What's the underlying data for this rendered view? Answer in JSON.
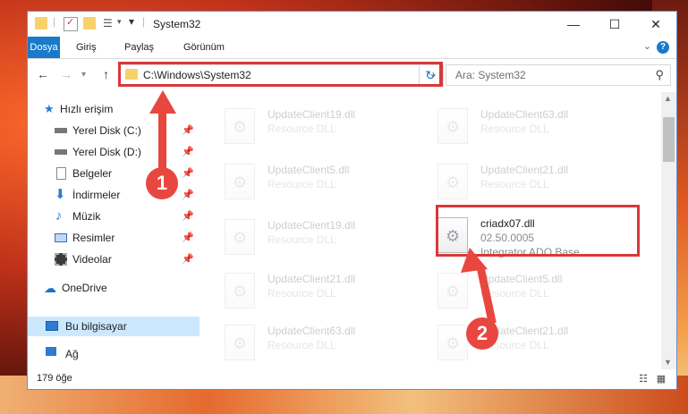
{
  "titlebar": {
    "title": "System32"
  },
  "ribbon": {
    "tabs": [
      "Dosya",
      "Giriş",
      "Paylaş",
      "Görünüm"
    ],
    "help_symbol": "?",
    "expand_symbol": "⌄"
  },
  "nav": {
    "address": "C:\\Windows\\System32",
    "search_placeholder": "Ara: System32"
  },
  "sidebar": {
    "items": [
      {
        "label": "Hızlı erişim",
        "icon": "star-icon"
      },
      {
        "label": "Yerel Disk (C:)",
        "icon": "drive-icon",
        "pinned": true
      },
      {
        "label": "Yerel Disk (D:)",
        "icon": "drive-icon",
        "pinned": true
      },
      {
        "label": "Belgeler",
        "icon": "documents-icon",
        "pinned": true
      },
      {
        "label": "İndirmeler",
        "icon": "download-icon",
        "pinned": true
      },
      {
        "label": "Müzik",
        "icon": "music-icon",
        "pinned": true
      },
      {
        "label": "Resimler",
        "icon": "pictures-icon",
        "pinned": true
      },
      {
        "label": "Videolar",
        "icon": "videos-icon",
        "pinned": true
      },
      {
        "label": "OneDrive",
        "icon": "cloud-icon"
      },
      {
        "label": "Bu bilgisayar",
        "icon": "computer-icon",
        "selected": true
      },
      {
        "label": "Ağ",
        "icon": "network-icon"
      }
    ]
  },
  "files": [
    {
      "name": "UpdateClient19.dll",
      "desc": "Resource DLL"
    },
    {
      "name": "UpdateClient63.dll",
      "desc": "Resource DLL"
    },
    {
      "name": "UpdateClient5.dll",
      "desc": "Resource DLL"
    },
    {
      "name": "UpdateClient21.dll",
      "desc": "Resource DLL"
    },
    {
      "name": "UpdateClient19.dll",
      "desc": "Resource DLL"
    },
    {
      "name": "criadx07.dll",
      "desc": "02.50.0005",
      "extra": "Integrator ADO Base",
      "highlighted": true
    },
    {
      "name": "UpdateClient21.dll",
      "desc": "Resource DLL"
    },
    {
      "name": "UpdateClient5.dll",
      "desc": "Resource DLL"
    },
    {
      "name": "UpdateClient63.dll",
      "desc": "Resource DLL"
    },
    {
      "name": "UpdateClient21.dll",
      "desc": "Resource DLL"
    }
  ],
  "status": {
    "count": "179 öğe"
  },
  "annotations": {
    "badge1": "1",
    "badge2": "2",
    "color": "#e8473f"
  }
}
